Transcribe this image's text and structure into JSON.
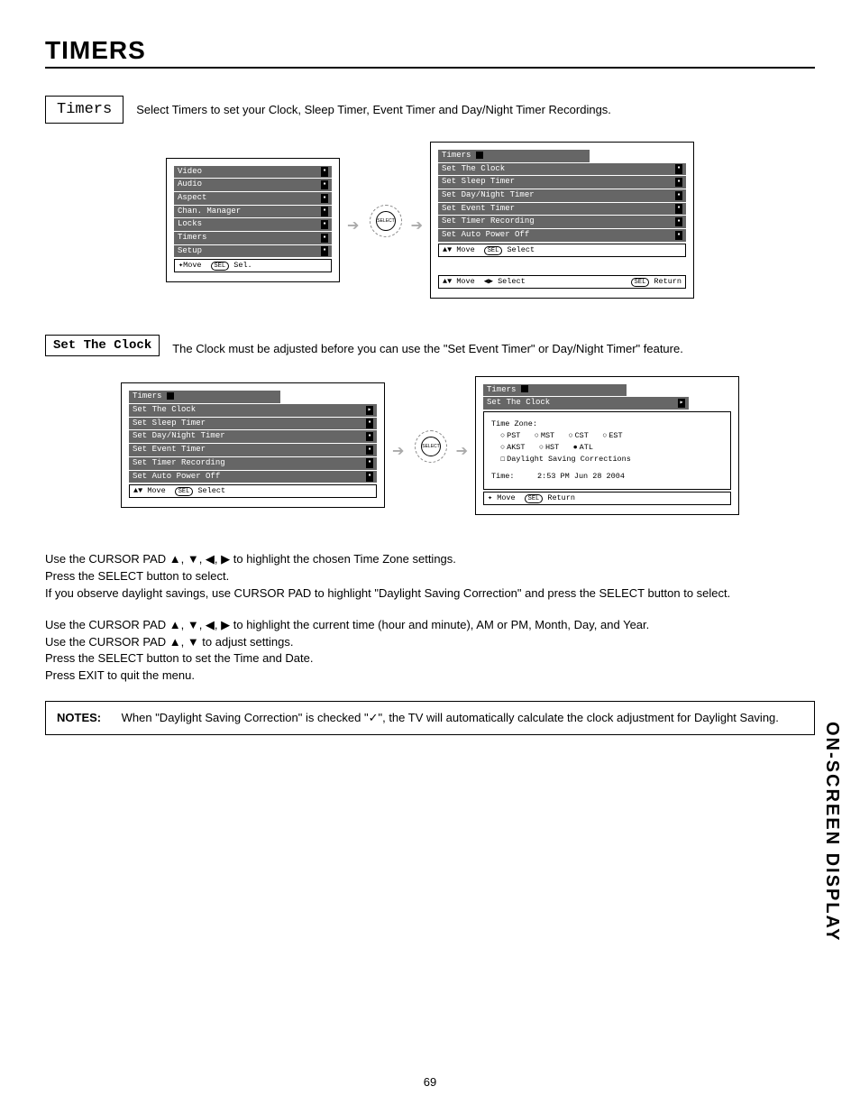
{
  "page": {
    "title": "TIMERS",
    "number": "69",
    "side_tab": "ON-SCREEN DISPLAY"
  },
  "sections": {
    "timers": {
      "label": "Timers",
      "desc": "Select Timers to set your Clock, Sleep Timer, Event Timer and Day/Night Timer Recordings."
    },
    "set_clock": {
      "label": "Set The Clock",
      "desc": "The Clock must be adjusted before you can use the \"Set Event Timer\" or Day/Night Timer\" feature."
    }
  },
  "fig1": {
    "left_menu": [
      "Video",
      "Audio",
      "Aspect",
      "Chan. Manager",
      "Locks",
      "Timers",
      "Setup"
    ],
    "left_hint_move": "Move",
    "left_hint_sel": "Sel.",
    "remote_label": "SELECT",
    "right_header": "Timers",
    "right_items": [
      "Set The Clock",
      "Set Sleep Timer",
      "Set Day/Night Timer",
      "Set Event Timer",
      "Set Timer Recording",
      "Set Auto Power Off"
    ],
    "right_hint1_move": "Move",
    "right_hint1_sel": "Select",
    "right_hint2_move": "Move",
    "right_hint2_sel": "Select",
    "right_hint2_ret": "Return"
  },
  "fig2": {
    "left_header": "Timers",
    "left_items": [
      "Set The Clock",
      "Set Sleep Timer",
      "Set Day/Night Timer",
      "Set Event Timer",
      "Set Timer Recording",
      "Set Auto Power Off"
    ],
    "left_hint_move": "Move",
    "left_hint_sel": "Select",
    "remote_label": "SELECT",
    "right_header": "Timers",
    "right_sub": "Set The Clock",
    "panel": {
      "tz_label": "Time Zone:",
      "zones1": [
        "PST",
        "MST",
        "CST",
        "EST"
      ],
      "zones2": [
        "AKST",
        "HST",
        "ATL"
      ],
      "dst": "Daylight Saving Corrections",
      "time_label": "Time:",
      "time_value": "2:53 PM Jun 28 2004"
    },
    "right_hint_move": "Move",
    "right_hint_ret": "Return"
  },
  "body": {
    "p1_a": "Use the CURSOR PAD ▲, ▼, ◀, ▶ to highlight the chosen Time Zone settings.",
    "p1_b": "Press the SELECT button to select.",
    "p1_c": "If you observe daylight savings, use CURSOR PAD to highlight \"Daylight Saving Correction\" and press the SELECT button to select.",
    "p2_a": "Use the CURSOR PAD ▲, ▼, ◀, ▶ to highlight the current time (hour and minute), AM or PM, Month, Day, and Year.",
    "p2_b": "Use the CURSOR PAD ▲, ▼ to adjust settings.",
    "p2_c": "Press the SELECT button to set the Time and Date.",
    "p2_d": "Press EXIT to quit the menu."
  },
  "notes": {
    "label": "NOTES:",
    "text": "When \"Daylight Saving Correction\" is checked \"✓\", the TV will automatically calculate the clock adjustment for Daylight Saving."
  }
}
